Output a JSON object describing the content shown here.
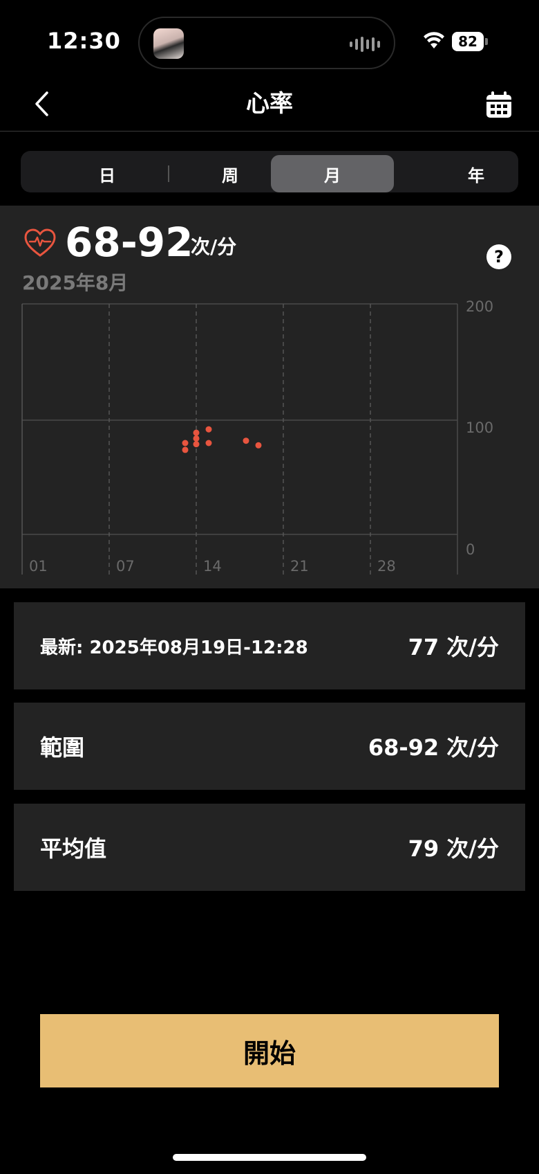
{
  "status_bar": {
    "time": "12:30",
    "battery": "82"
  },
  "nav": {
    "title": "心率"
  },
  "segments": [
    "日",
    "周",
    "月",
    "年"
  ],
  "active_segment": "月",
  "summary": {
    "range": "68-92",
    "unit": "次/分",
    "period": "2025年8月"
  },
  "chart_data": {
    "type": "scatter",
    "x_ticks": [
      "01",
      "07",
      "14",
      "21",
      "28"
    ],
    "y_ticks": [
      "200",
      "100",
      "0"
    ],
    "ylim": [
      0,
      200
    ],
    "xlim": [
      1,
      31
    ],
    "grid": true,
    "color": "#e8553f",
    "points": [
      {
        "x": 13,
        "y": 80
      },
      {
        "x": 13,
        "y": 74
      },
      {
        "x": 14,
        "y": 89
      },
      {
        "x": 14,
        "y": 84
      },
      {
        "x": 14,
        "y": 79
      },
      {
        "x": 15,
        "y": 92
      },
      {
        "x": 15,
        "y": 80
      },
      {
        "x": 18,
        "y": 82
      },
      {
        "x": 19,
        "y": 78
      }
    ]
  },
  "cards": {
    "latest": {
      "label": "最新: 2025年08月19日-12:28",
      "value": "77 次/分"
    },
    "range": {
      "label": "範圍",
      "value": "68-92 次/分"
    },
    "average": {
      "label": "平均值",
      "value": "79 次/分"
    }
  },
  "start_button": "開始",
  "colors": {
    "accent": "#e8be74",
    "heart": "#e8553f",
    "panel": "#232323"
  }
}
